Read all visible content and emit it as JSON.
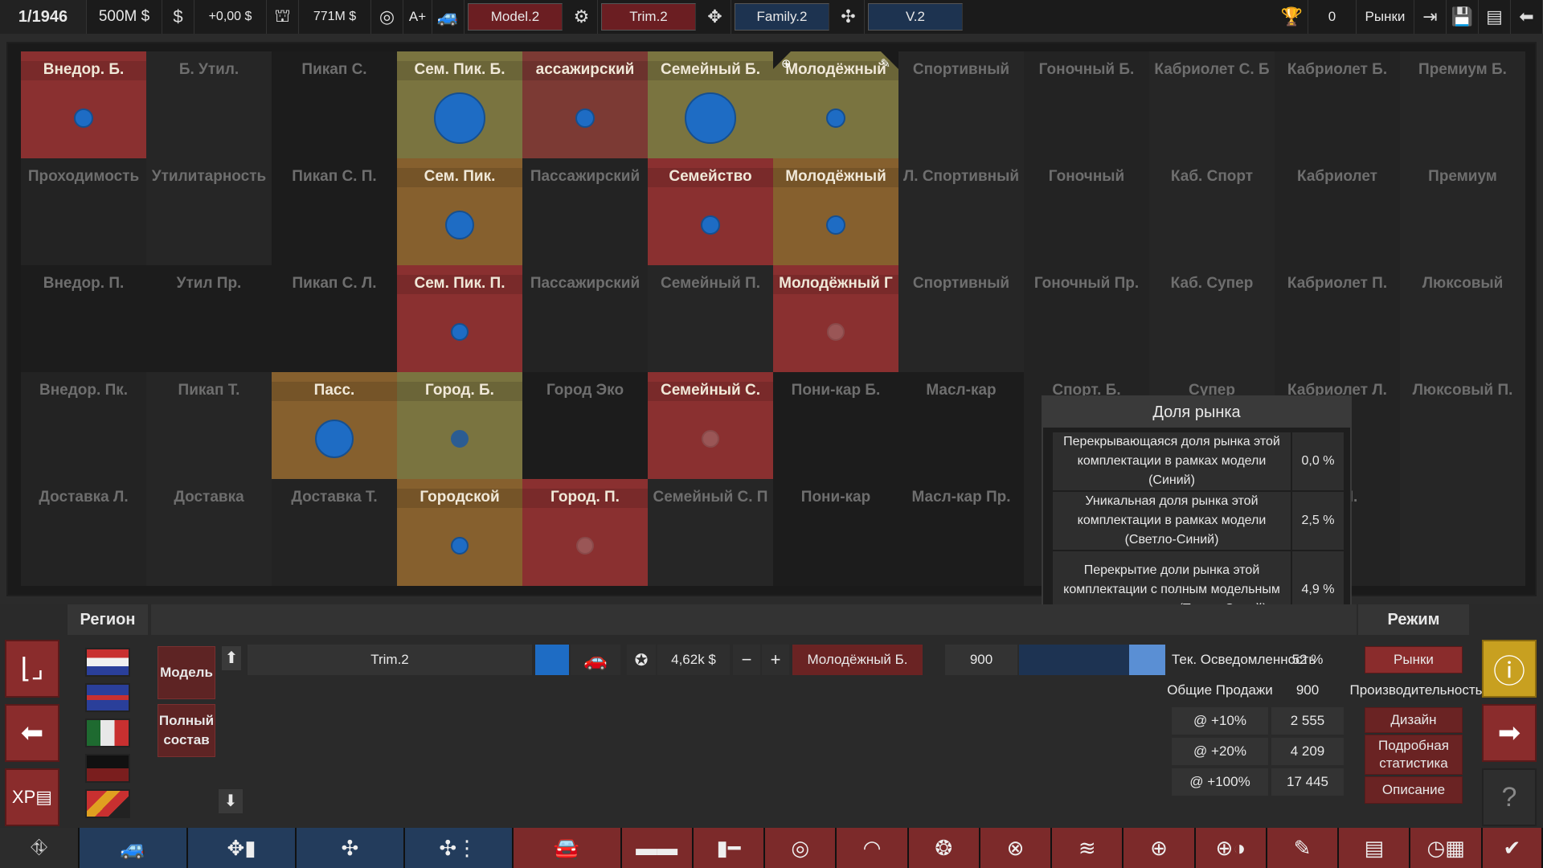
{
  "topbar": {
    "date": "1/1946",
    "funds": "500M $",
    "dollar_icon": "$",
    "income": "+0,00 $",
    "value": "771M $",
    "rating": "A+",
    "model": "Model.2",
    "trim": "Trim.2",
    "family": "Family.2",
    "version": "V.2",
    "trophy_count": "0",
    "markets": "Рынки"
  },
  "grid": [
    {
      "label": "Внедор. Б.",
      "tone": "red",
      "dot": "small"
    },
    {
      "label": "Б. Утил.",
      "tone": "plain"
    },
    {
      "label": "Пикап С.",
      "tone": "dark"
    },
    {
      "label": "Сем. Пик. Б.",
      "tone": "olive",
      "dot": "large"
    },
    {
      "label": "ассажирский",
      "tone": "palered",
      "dot": "small"
    },
    {
      "label": "Семейный Б.",
      "tone": "olive",
      "dot": "large"
    },
    {
      "label": "Молодёжный",
      "tone": "olive",
      "dot": "small",
      "selected": true
    },
    {
      "label": "Спортивный",
      "tone": "plain"
    },
    {
      "label": "Гоночный Б.",
      "tone": "plain"
    },
    {
      "label": "Кабриолет С. Б",
      "tone": "plain"
    },
    {
      "label": "Кабриолет Б.",
      "tone": "plain"
    },
    {
      "label": "Премиум Б.",
      "tone": "plain"
    },
    {
      "label": "Проходимость",
      "tone": "plain"
    },
    {
      "label": "Утилитарность",
      "tone": "plain"
    },
    {
      "label": "Пикап С. П.",
      "tone": "dark"
    },
    {
      "label": "Сем. Пик.",
      "tone": "orange",
      "dot": "medium"
    },
    {
      "label": "Пассажирский",
      "tone": "plain"
    },
    {
      "label": "Семейство",
      "tone": "red",
      "dot": "small"
    },
    {
      "label": "Молодёжный",
      "tone": "orange",
      "dot": "small"
    },
    {
      "label": "Л. Спортивный",
      "tone": "plain"
    },
    {
      "label": "Гоночный",
      "tone": "plain"
    },
    {
      "label": "Каб. Спорт",
      "tone": "plain"
    },
    {
      "label": "Кабриолет",
      "tone": "plain"
    },
    {
      "label": "Премиум",
      "tone": "plain"
    },
    {
      "label": "Внедор. П.",
      "tone": "dark"
    },
    {
      "label": "Утил Пр.",
      "tone": "dark"
    },
    {
      "label": "Пикап С. Л.",
      "tone": "dark"
    },
    {
      "label": "Сем. Пик. П.",
      "tone": "red",
      "dot": "tiny"
    },
    {
      "label": "Пассажирский",
      "tone": "plain"
    },
    {
      "label": "Семейный П.",
      "tone": "plain"
    },
    {
      "label": "Молодёжный Г",
      "tone": "red",
      "dot": "grey"
    },
    {
      "label": "Спортивный",
      "tone": "plain"
    },
    {
      "label": "Гоночный Пр.",
      "tone": "plain"
    },
    {
      "label": "Каб. Супер",
      "tone": "plain"
    },
    {
      "label": "Кабриолет П.",
      "tone": "plain"
    },
    {
      "label": "Люксовый",
      "tone": "plain"
    },
    {
      "label": "Внедор. Пк.",
      "tone": "plain"
    },
    {
      "label": "Пикап Т.",
      "tone": "plain"
    },
    {
      "label": "Пасс.",
      "tone": "orange",
      "dot": "large2"
    },
    {
      "label": "Город. Б.",
      "tone": "olive",
      "dot": "tinydim"
    },
    {
      "label": "Город Эко",
      "tone": "dark"
    },
    {
      "label": "Семейный С.",
      "tone": "red",
      "dot": "grey"
    },
    {
      "label": "Пони-кар Б.",
      "tone": "dark"
    },
    {
      "label": "Масл-кар",
      "tone": "dark"
    },
    {
      "label": "Спорт. Б.",
      "tone": "plain"
    },
    {
      "label": "Супер",
      "tone": "plain"
    },
    {
      "label": "Кабриолет Л.",
      "tone": "plain"
    },
    {
      "label": "Люксовый П.",
      "tone": "plain"
    },
    {
      "label": "Доставка Л.",
      "tone": "plain"
    },
    {
      "label": "Доставка",
      "tone": "plain"
    },
    {
      "label": "Доставка Т.",
      "tone": "plain"
    },
    {
      "label": "Городской",
      "tone": "orange",
      "dot": "tiny"
    },
    {
      "label": "Город. П.",
      "tone": "red",
      "dot": "grey"
    },
    {
      "label": "Семейный С. П",
      "tone": "plain"
    },
    {
      "label": "Пони-кар",
      "tone": "dark"
    },
    {
      "label": "Масл-кар Пр.",
      "tone": "dark"
    },
    {
      "label": "",
      "tone": "plain"
    },
    {
      "label": "",
      "tone": "plain"
    },
    {
      "label": "GT П.",
      "tone": "plain"
    },
    {
      "label": "",
      "tone": "plain"
    }
  ],
  "tooltip": {
    "title": "Доля рынка",
    "rows": [
      {
        "desc": "Перекрывающаяся доля рынка этой комплектации в рамках модели (Синий)",
        "value": "0,0 %"
      },
      {
        "desc": "Уникальная доля рынка этой комплектации в рамках модели (Светло-Синий)",
        "value": "2,5 %"
      },
      {
        "desc": "Перекрытие доли рынка этой комплектации с полным модельным рядом компании (Темно-Синий)",
        "value": "4,9 %"
      }
    ]
  },
  "bottom": {
    "region_title": "Регион",
    "mode_title": "Режим",
    "model_button": "Модель",
    "full_lineup_button": "Полный состав",
    "trim_name": "Trim.2",
    "price": "4,62k $",
    "segment": "Молодёжный Б.",
    "units": "900",
    "awareness_label": "Тек. Осведомленность",
    "awareness_value": "52 %",
    "total_sales_label": "Общие Продажи",
    "total_sales_value": "900",
    "production_label": "Производительность",
    "stats": [
      {
        "label": "@ +10%",
        "value": "2 555"
      },
      {
        "label": "@ +20%",
        "value": "4 209"
      },
      {
        "label": "@ +100%",
        "value": "17 445"
      }
    ],
    "mode_buttons": [
      "Рынки",
      "Дизайн",
      "Подробная статистика",
      "Описание"
    ],
    "share_fraction": 0.25
  },
  "colors": {
    "accent_red": "#8a2c2c",
    "accent_blue": "#1e6cc4",
    "tab_blue": "#233c5c"
  }
}
